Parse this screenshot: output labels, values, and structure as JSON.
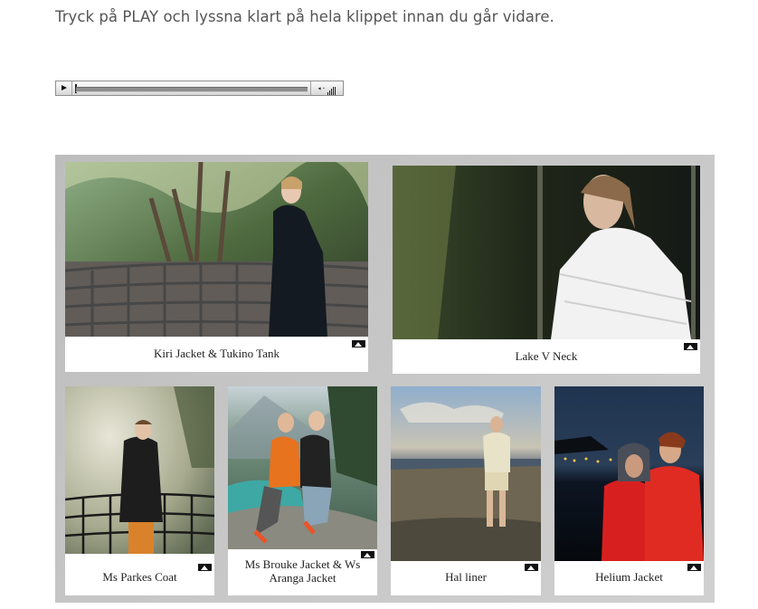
{
  "instruction": "Tryck på PLAY och lyssna klart på hela klippet innan du går vidare.",
  "player": {
    "play_icon": "play-icon",
    "volume_icon": "speaker-volume-icon",
    "volume_text": "◂·ılıl"
  },
  "gallery": {
    "badge_icon": "mountain-logo-icon",
    "items": [
      {
        "caption": "Kiri Jacket & Tukino Tank"
      },
      {
        "caption": "Lake V Neck"
      },
      {
        "caption": "Ms Parkes Coat"
      },
      {
        "caption": "Ms Brouke Jacket & Ws Aranga Jacket"
      },
      {
        "caption": "Hal liner"
      },
      {
        "caption": "Helium Jacket"
      }
    ]
  }
}
